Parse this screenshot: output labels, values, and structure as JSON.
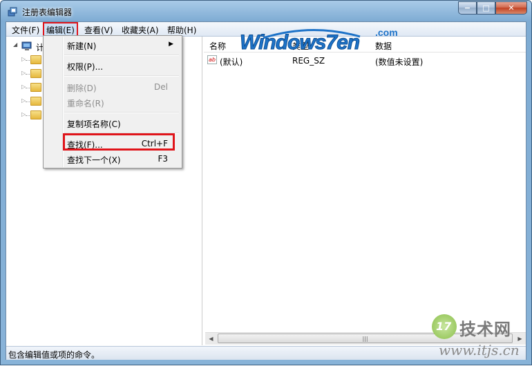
{
  "window": {
    "title": "注册表编辑器",
    "minimize_label": "−",
    "maximize_label": "□",
    "close_label": "✕"
  },
  "menubar": {
    "items": [
      "文件(F)",
      "编辑(E)",
      "查看(V)",
      "收藏夹(A)",
      "帮助(H)"
    ],
    "active": "编辑(E)"
  },
  "tree": {
    "root_label": "计",
    "expander_glyph": "▷"
  },
  "edit_menu": {
    "items": [
      {
        "label": "新建(N)",
        "shortcut": "",
        "submenu": true,
        "enabled": true
      },
      {
        "label": "权限(P)...",
        "shortcut": "",
        "submenu": false,
        "enabled": true
      },
      {
        "label": "删除(D)",
        "shortcut": "Del",
        "submenu": false,
        "enabled": false
      },
      {
        "label": "重命名(R)",
        "shortcut": "",
        "submenu": false,
        "enabled": false
      },
      {
        "label": "复制项名称(C)",
        "shortcut": "",
        "submenu": false,
        "enabled": true
      },
      {
        "label": "查找(F)...",
        "shortcut": "Ctrl+F",
        "submenu": false,
        "enabled": true,
        "highlighted": true
      },
      {
        "label": "查找下一个(X)",
        "shortcut": "F3",
        "submenu": false,
        "enabled": true
      }
    ],
    "submenu_arrow": "▶"
  },
  "list": {
    "columns": [
      "名称",
      "类型",
      "数据"
    ],
    "rows": [
      {
        "icon": "ab",
        "name": "(默认)",
        "type": "REG_SZ",
        "data": "(数值未设置)"
      }
    ]
  },
  "scrollbar": {
    "left_arrow": "◀",
    "right_arrow": "▶",
    "grip": "|||"
  },
  "statusbar": {
    "text": "包含编辑值或项的命令。"
  },
  "watermarks": {
    "logo_text": "Windows7en",
    "logo_suffix": ".com",
    "site_number": "17",
    "site_name": "技术网",
    "site_url": "www.itjs.cn"
  },
  "colors": {
    "highlight_border": "#e0141a",
    "logo_blue": "#1e73c8",
    "title_gradient_top": "#a9cbe8"
  }
}
